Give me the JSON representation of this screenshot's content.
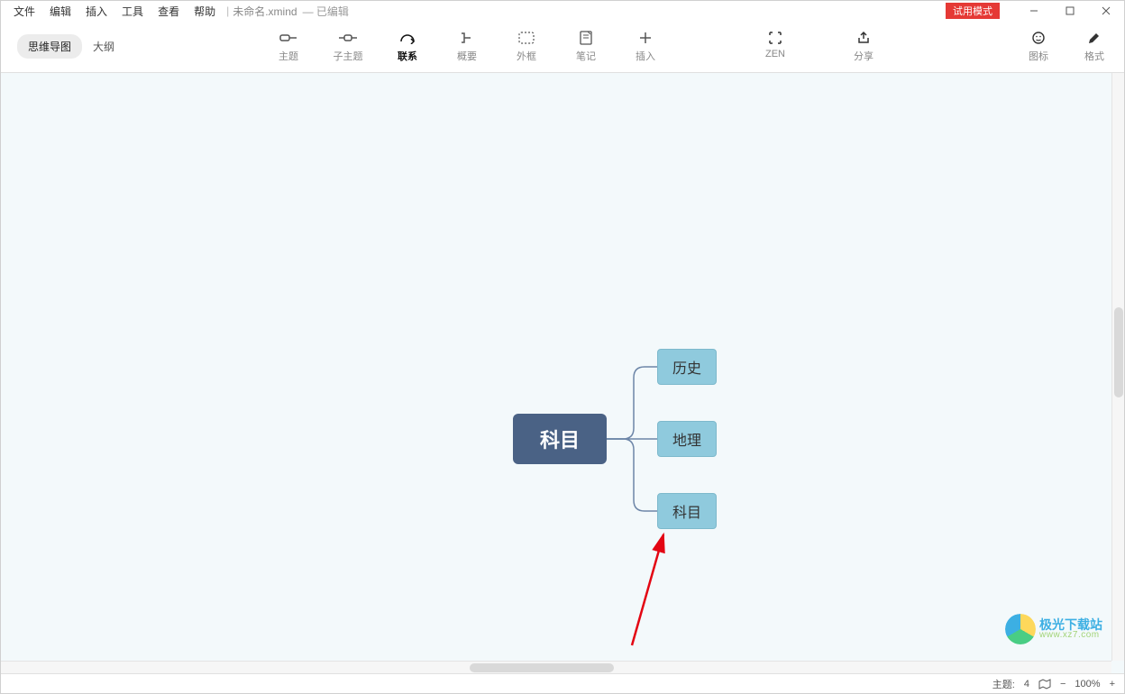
{
  "menubar": {
    "items": [
      "文件",
      "编辑",
      "插入",
      "工具",
      "查看",
      "帮助"
    ],
    "doc_title": "未命名.xmind",
    "doc_state": "— 已编辑"
  },
  "window": {
    "trial_badge": "试用模式"
  },
  "view_tabs": {
    "mindmap": "思维导图",
    "outline": "大纲"
  },
  "toolbar": {
    "topic": "主题",
    "subtopic": "子主题",
    "relation": "联系",
    "summary": "概要",
    "boundary": "外框",
    "note": "笔记",
    "insert": "插入",
    "zen": "ZEN",
    "share": "分享",
    "icons": "图标",
    "format": "格式"
  },
  "mindmap": {
    "central": "科目",
    "children": [
      "历史",
      "地理",
      "科目"
    ]
  },
  "statusbar": {
    "topic_label": "主题:",
    "topic_count": "4",
    "zoom_level": "100%"
  },
  "watermark": {
    "line1": "极光下载站",
    "line2": "www.xz7.com"
  }
}
